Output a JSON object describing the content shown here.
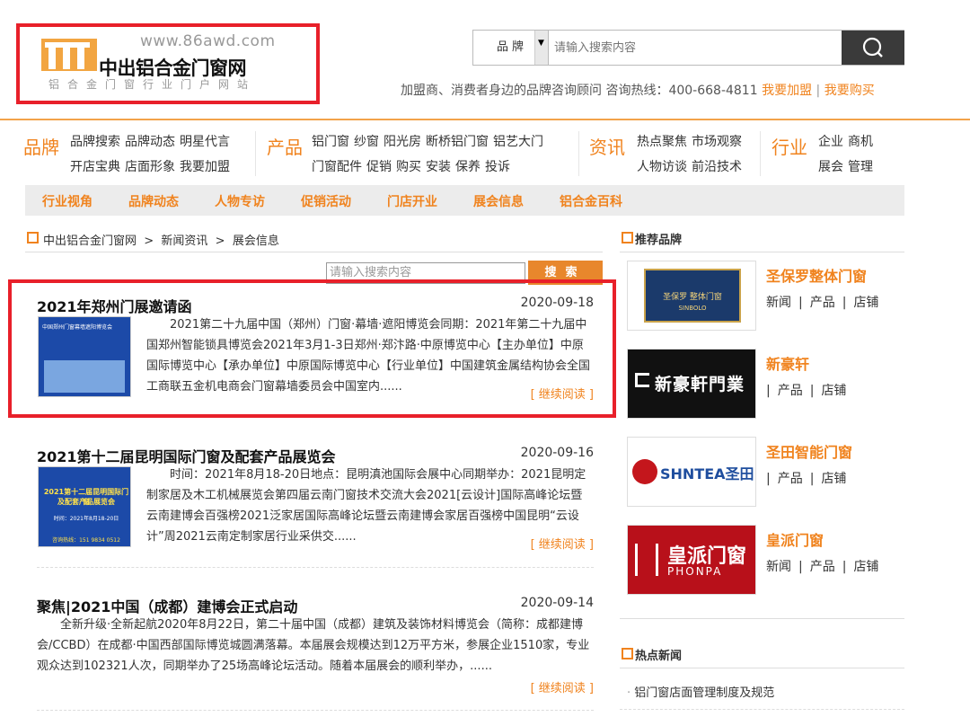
{
  "header": {
    "logo_url": "www.86awd.com",
    "logo_name": "中出铝合金门窗网",
    "logo_slogan": "铝合金门窗行业门户网站",
    "search_category": "品牌",
    "search_placeholder": "请输入搜索内容",
    "hotline_text": "加盟商、消费者身边的品牌咨询顾问 咨询热线：400-668-4811",
    "join_link": "我要加盟",
    "buy_link": "我要购买",
    "sep": "|"
  },
  "topnav": {
    "groups": [
      {
        "cat": "品牌",
        "rows": [
          [
            "品牌搜索",
            "品牌动态",
            "明星代言"
          ],
          [
            "开店宝典",
            "店面形象",
            "我要加盟"
          ]
        ]
      },
      {
        "cat": "产品",
        "rows": [
          [
            "铝门窗",
            "纱窗",
            "阳光房",
            "断桥铝门窗",
            "铝艺大门"
          ],
          [
            "门窗配件",
            "促销",
            "购买",
            "安装",
            "保养",
            "投诉"
          ]
        ]
      },
      {
        "cat": "资讯",
        "rows": [
          [
            "热点聚焦",
            "市场观察"
          ],
          [
            "人物访谈",
            "前沿技术"
          ]
        ]
      },
      {
        "cat": "行业",
        "rows": [
          [
            "企业",
            "商机"
          ],
          [
            "展会",
            "管理"
          ]
        ]
      }
    ]
  },
  "subnav": [
    "行业视角",
    "品牌动态",
    "人物专访",
    "促销活动",
    "门店开业",
    "展会信息",
    "铝合金百科"
  ],
  "breadcrumb": "中出铝合金门窗网  >  新闻资讯  >  展会信息",
  "search2": {
    "placeholder": "请输入搜索内容",
    "button": "搜索"
  },
  "articles": [
    {
      "title": "2021年郑州门展邀请函",
      "date": "2020-09-18",
      "body": "2021第二十九届中国（郑州）门窗·幕墙·遮阳博览会同期：2021年第二十九届中国郑州智能锁具博览会2021年3月1-3日郑州·郑汴路·中原博览中心【主办单位】中原国际博览中心【承办单位】中原国际博览中心【行业单位】中国建筑金属结构协会全国工商联五金机电商会门窗幕墙委员会中国室内......",
      "more": "[ 继续阅读 ]"
    },
    {
      "title": "2021第十二届昆明国际门窗及配套产品展览会",
      "date": "2020-09-16",
      "body": "时间：2021年8月18-20日地点：昆明滇池国际会展中心同期举办：2021昆明定制家居及木工机械展览会第四届云南门窗技术交流大会2021[云设计]国际高峰论坛暨云南建博会百强榜2021泛家居国际高峰论坛暨云南建博会家居百强榜中国昆明“云设计”周2021云南定制家居行业采供交......",
      "more": "[ 继续阅读 ]"
    },
    {
      "title": "聚焦|2021中国（成都）建博会正式启动",
      "date": "2020-09-14",
      "body": "全新升级·全新起航2020年8月22日，第二十届中国（成都）建筑及装饰材料博览会（简称：成都建博会/CCBD）在成都·中国西部国际博览城圆满落幕。本届展会规模达到12万平方米，参展企业1510家，专业观众达到102321人次，同期举办了25场高峰论坛活动。随着本届展会的顺利举办，......",
      "more": "[ 继续阅读 ]"
    }
  ],
  "sidebar": {
    "brands_title": "推荐品牌",
    "brands": [
      {
        "name": "圣保罗整体门窗",
        "links": [
          "新闻",
          "|",
          "产品",
          "|",
          "店铺"
        ]
      },
      {
        "name": "新豪轩",
        "links": [
          "|",
          "产品",
          "|",
          "店铺"
        ]
      },
      {
        "name": "圣田智能门窗",
        "links": [
          "|",
          "产品",
          "|",
          "店铺"
        ]
      },
      {
        "name": "皇派门窗",
        "links": [
          "新闻",
          "|",
          "产品",
          "|",
          "店铺"
        ]
      }
    ],
    "logo_texts": [
      "圣保罗 整体门窗",
      "SINBOLO",
      "新豪軒門業",
      "SHNTEA圣田",
      "皇派门窗",
      "PHONPA"
    ],
    "news_title": "热点新闻",
    "news": [
      "铝门窗店面管理制度及规范"
    ]
  },
  "thumbs": {
    "a1_line1": "中国郑州门窗幕墙遮阳博览会",
    "a2_line1": "2021第十二届昆明国际门窗",
    "a2_line2": "及配套产品展览会",
    "a2_line3": "时间：2021年8月18-20日",
    "a2_line4": "咨询热线：151 9834 0512"
  },
  "colors": {
    "accent": "#f0831e",
    "highlight": "#e8202a",
    "search_btn": "#3a3a3a"
  }
}
